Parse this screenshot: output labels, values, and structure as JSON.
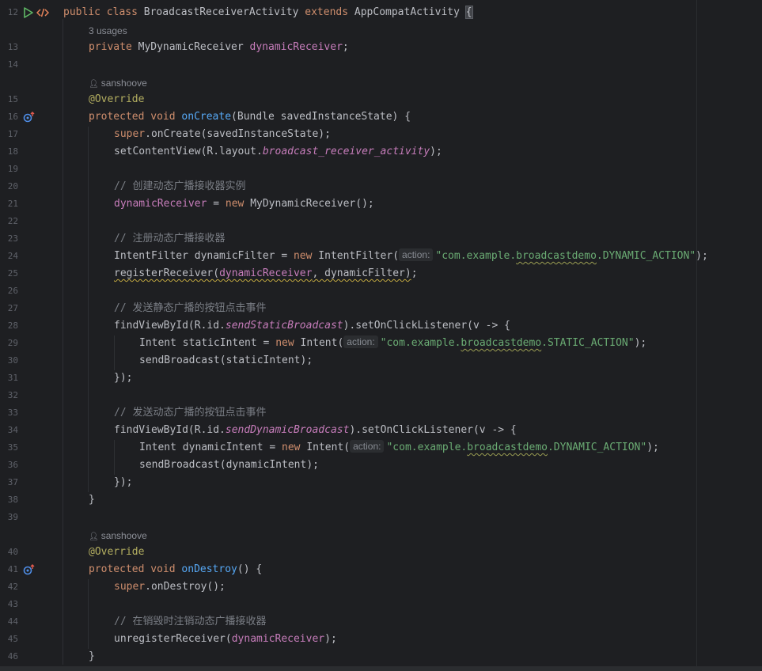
{
  "editor": {
    "line12": {
      "num": "12",
      "t1": "public",
      "t2": "class",
      "t3": "BroadcastReceiverActivity",
      "t4": "extends",
      "t5": "AppCompatActivity",
      "t6": "{"
    },
    "usages": "3 usages",
    "line13": {
      "num": "13",
      "t1": "private",
      "t2": "MyDynamicReceiver",
      "t3": "dynamicReceiver",
      "t4": ";"
    },
    "line14": {
      "num": "14"
    },
    "author1": "sanshoove",
    "line15": {
      "num": "15",
      "t1": "@Override"
    },
    "line16": {
      "num": "16",
      "t1": "protected",
      "t2": "void",
      "t3": "onCreate",
      "t4": "(Bundle savedInstanceState) {"
    },
    "line17": {
      "num": "17",
      "t1": "super",
      "t2": ".onCreate(savedInstanceState);"
    },
    "line18": {
      "num": "18",
      "t1": "setContentView(R.layout.",
      "t2": "broadcast_receiver_activity",
      "t3": ");"
    },
    "line19": {
      "num": "19"
    },
    "line20": {
      "num": "20",
      "t1": "// 创建动态广播接收器实例"
    },
    "line21": {
      "num": "21",
      "t1": "dynamicReceiver",
      "t2": " = ",
      "t3": "new",
      "t4": " MyDynamicReceiver();"
    },
    "line22": {
      "num": "22"
    },
    "line23": {
      "num": "23",
      "t1": "// 注册动态广播接收器"
    },
    "line24": {
      "num": "24",
      "t1": "IntentFilter dynamicFilter = ",
      "t2": "new",
      "t3": " IntentFilter(",
      "hint": "action:",
      "s1": "\"com.example.",
      "s2": "broadcastdemo",
      "s3": ".DYNAMIC_ACTION\"",
      "t4": ");"
    },
    "line25": {
      "num": "25",
      "t1": "registerReceiver(",
      "t2": "dynamicReceiver",
      "t3": ", dynamicFilter)",
      "t4": ";"
    },
    "line26": {
      "num": "26"
    },
    "line27": {
      "num": "27",
      "t1": "// 发送静态广播的按钮点击事件"
    },
    "line28": {
      "num": "28",
      "t1": "findViewById(R.id.",
      "t2": "sendStaticBroadcast",
      "t3": ").setOnClickListener(v -> {"
    },
    "line29": {
      "num": "29",
      "t1": "Intent staticIntent = ",
      "t2": "new",
      "t3": " Intent(",
      "hint": "action:",
      "s1": "\"com.example.",
      "s2": "broadcastdemo",
      "s3": ".STATIC_ACTION\"",
      "t4": ");"
    },
    "line30": {
      "num": "30",
      "t1": "sendBroadcast(staticIntent);"
    },
    "line31": {
      "num": "31",
      "t1": "});"
    },
    "line32": {
      "num": "32"
    },
    "line33": {
      "num": "33",
      "t1": "// 发送动态广播的按钮点击事件"
    },
    "line34": {
      "num": "34",
      "t1": "findViewById(R.id.",
      "t2": "sendDynamicBroadcast",
      "t3": ").setOnClickListener(v -> {"
    },
    "line35": {
      "num": "35",
      "t1": "Intent dynamicIntent = ",
      "t2": "new",
      "t3": " Intent(",
      "hint": "action:",
      "s1": "\"com.example.",
      "s2": "broadcastdemo",
      "s3": ".DYNAMIC_ACTION\"",
      "t4": ");"
    },
    "line36": {
      "num": "36",
      "t1": "sendBroadcast(dynamicIntent);"
    },
    "line37": {
      "num": "37",
      "t1": "});"
    },
    "line38": {
      "num": "38",
      "t1": "}"
    },
    "line39": {
      "num": "39"
    },
    "author2": "sanshoove",
    "line40": {
      "num": "40",
      "t1": "@Override"
    },
    "line41": {
      "num": "41",
      "t1": "protected",
      "t2": "void",
      "t3": "onDestroy",
      "t4": "() {"
    },
    "line42": {
      "num": "42",
      "t1": "super",
      "t2": ".onDestroy();"
    },
    "line43": {
      "num": "43"
    },
    "line44": {
      "num": "44",
      "t1": "// 在销毁时注销动态广播接收器"
    },
    "line45": {
      "num": "45",
      "t1": "unregisterReceiver(",
      "t2": "dynamicReceiver",
      "t3": ");"
    },
    "line46": {
      "num": "46",
      "t1": "}"
    }
  },
  "icons": {
    "run": "run-icon",
    "tag": "html-tag-icon",
    "override": "override-up-arrow-icon",
    "person": "person-icon"
  },
  "colors": {
    "background": "#1e1f22",
    "keyword": "#cf8e6d",
    "field": "#c77dbb",
    "method": "#56a8f5",
    "annotation": "#b3ae60",
    "string": "#6aab73",
    "comment": "#7a7e85"
  }
}
